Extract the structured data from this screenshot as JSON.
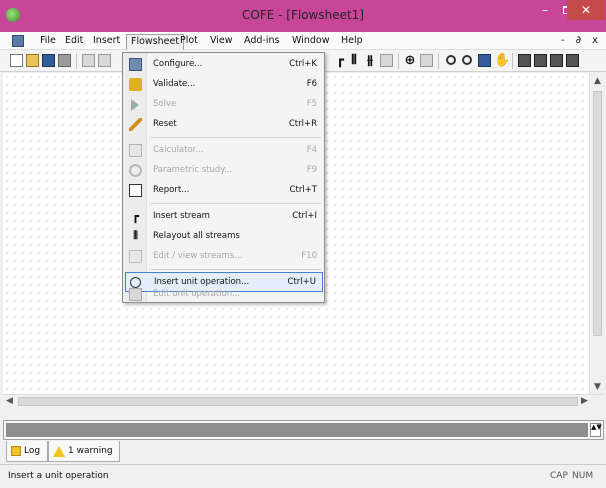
{
  "window": {
    "title": "COFE - [Flowsheet1]",
    "min_glyph": "–",
    "close_glyph": "✕"
  },
  "menubar": {
    "items": [
      "File",
      "Edit",
      "Insert",
      "Flowsheet",
      "Plot",
      "View",
      "Add-ins",
      "Window",
      "Help"
    ],
    "active": "Flowsheet",
    "mdi_controls": "- ∂ x"
  },
  "dropdown": {
    "items": [
      {
        "label": "Configure...",
        "shortcut": "Ctrl+K",
        "icon": "configure-icon",
        "enabled": true
      },
      {
        "label": "Validate...",
        "shortcut": "F6",
        "icon": "validate-icon",
        "enabled": true
      },
      {
        "label": "Solve",
        "shortcut": "F5",
        "icon": "solve-icon",
        "enabled": false
      },
      {
        "label": "Reset",
        "shortcut": "Ctrl+R",
        "icon": "reset-icon",
        "enabled": true
      },
      {
        "label": "Calculator...",
        "shortcut": "F4",
        "icon": "calculator-icon",
        "enabled": false
      },
      {
        "label": "Parametric study...",
        "shortcut": "F9",
        "icon": "parametric-icon",
        "enabled": false
      },
      {
        "label": "Report...",
        "shortcut": "Ctrl+T",
        "icon": "report-icon",
        "enabled": true
      },
      {
        "label": "Insert stream",
        "shortcut": "Ctrl+I",
        "icon": "stream-icon",
        "enabled": true
      },
      {
        "label": "Relayout all streams",
        "shortcut": "",
        "icon": "relayout-icon",
        "enabled": true
      },
      {
        "label": "Edit / view streams...",
        "shortcut": "F10",
        "icon": "edit-streams-icon",
        "enabled": false
      },
      {
        "label": "Insert unit operation...",
        "shortcut": "Ctrl+U",
        "icon": "unit-op-icon",
        "enabled": true,
        "highlighted": true
      },
      {
        "label": "Edit unit operation...",
        "shortcut": "",
        "icon": "edit-unit-icon",
        "enabled": false
      }
    ]
  },
  "tabs": {
    "log": "Log",
    "warning": "1 warning"
  },
  "scroll_arrows": {
    "up": "▲",
    "down": "▼",
    "left": "◀",
    "right": "▶",
    "spin": "▲▼"
  },
  "statusbar": {
    "message": "Insert a unit operation",
    "cap": "CAP",
    "num": "NUM"
  },
  "colors": {
    "titlebar": "#c7469a",
    "close_button": "#c74a4a",
    "highlight_border": "#4a7fd0"
  }
}
